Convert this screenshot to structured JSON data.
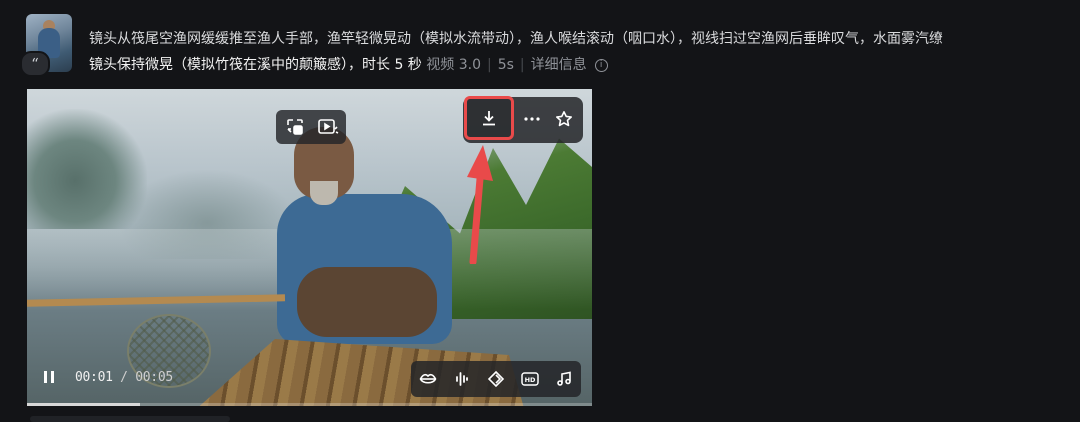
{
  "card": {
    "prompt_line1": "镜头从筏尾空渔网缓缓推至渔人手部，渔竿轻微晃动（模拟水流带动），渔人喉结滚动（咽口水），视线扫过空渔网后垂眸叹气，水面雾汽缭",
    "prompt_line2": "镜头保持微晃（模拟竹筏在溪中的颠簸感），时长 5 秒",
    "model": "视频 3.0",
    "duration_tag": "5s",
    "detail_link": "详细信息"
  },
  "player": {
    "time_current": "00:01",
    "time_sep": " / ",
    "time_total": "00:05",
    "progress": 0.2
  },
  "icons": {
    "quote": "quote-icon",
    "info": "info-icon",
    "swap": "swap-frame-icon",
    "play_magic": "play-magic-icon",
    "download": "download-icon",
    "more": "more-icon",
    "star": "star-icon",
    "pause": "pause-icon",
    "lip_sync": "lip-sync-icon",
    "audio_wave": "audio-wave-icon",
    "diamond": "frame-interpolate-icon",
    "hd": "hd-icon",
    "music": "music-icon"
  },
  "annotation": {
    "arrow_color": "#e94a4a",
    "highlight_color": "#e94a4a"
  }
}
